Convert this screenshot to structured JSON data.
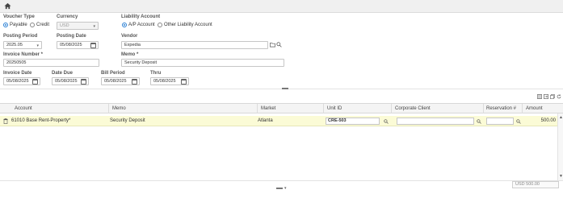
{
  "form": {
    "voucher_type": {
      "label": "Voucher Type",
      "options": [
        "Payable",
        "Credit"
      ],
      "selected": "Payable"
    },
    "currency": {
      "label": "Currency",
      "value": "USD"
    },
    "liability_account": {
      "label": "Liability Account",
      "options": [
        "A/P Account",
        "Other Liability Account"
      ],
      "selected": "A/P Account"
    },
    "posting_period": {
      "label": "Posting Period",
      "value": "2025.05"
    },
    "posting_date": {
      "label": "Posting Date",
      "value": "05/08/2025"
    },
    "vendor": {
      "label": "Vendor",
      "value": "Expedia"
    },
    "invoice_number": {
      "label": "Invoice Number *",
      "value": "20250505"
    },
    "memo": {
      "label": "Memo *",
      "value": "Security Deposit"
    },
    "invoice_date": {
      "label": "Invoice Date",
      "value": "05/08/2025"
    },
    "date_due": {
      "label": "Date Due",
      "value": "05/08/2025"
    },
    "bill_period": {
      "label": "Bill Period",
      "value": "05/08/2025"
    },
    "thru": {
      "label": "Thru",
      "value": "05/08/2025"
    }
  },
  "grid": {
    "columns": [
      "Account",
      "Memo",
      "Market",
      "Unit ID",
      "Corporate Client",
      "Reservation #",
      "Amount"
    ],
    "rows": [
      {
        "account": "61010 Base Rent-Property*",
        "memo": "Security Deposit",
        "market": "Atlanta",
        "unit_id": "CRE-503",
        "corporate_client": "",
        "reservation": "",
        "amount": "500.00"
      }
    ],
    "total": "USD 500.00"
  },
  "icons": [
    "home-icon",
    "folder-icon",
    "search-icon",
    "calendar-icon",
    "trash-icon",
    "columns-icon",
    "export-icon",
    "copy-icon",
    "refresh-icon"
  ],
  "colors": {
    "accent": "#2a7fd4",
    "row_highlight": "#fbfbd6"
  }
}
